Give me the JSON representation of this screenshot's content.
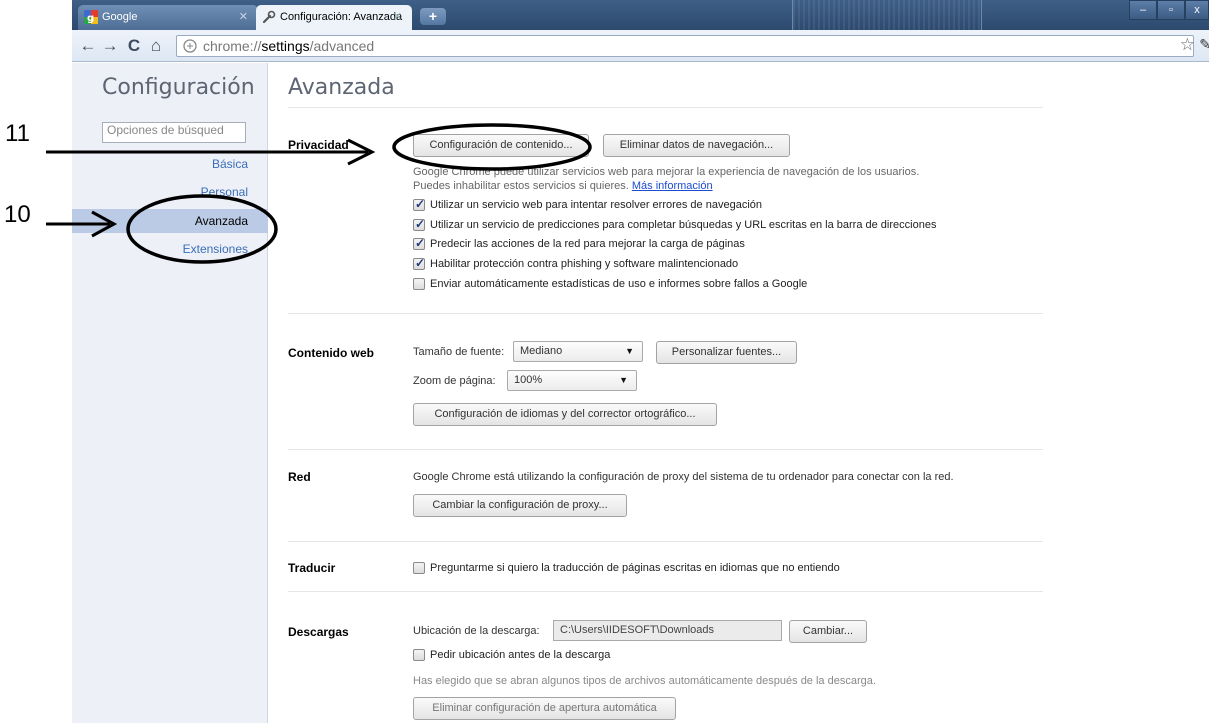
{
  "browser": {
    "tabs": [
      {
        "title": "Google",
        "active": false
      },
      {
        "title": "Configuración: Avanzada",
        "active": true
      }
    ],
    "new_tab_label": "+",
    "address": {
      "scheme": "chrome://",
      "host": "settings",
      "path": "/advanced"
    },
    "window_controls": {
      "minimize": "–",
      "maximize": "▫",
      "close": "x"
    }
  },
  "sidebar": {
    "title": "Configuración",
    "search_placeholder": "Opciones de búsqued",
    "items": [
      {
        "label": "Básica",
        "selected": false
      },
      {
        "label": "Personal",
        "selected": false
      },
      {
        "label": "Avanzada",
        "selected": true
      },
      {
        "label": "Extensiones",
        "selected": false
      }
    ]
  },
  "main": {
    "title": "Avanzada",
    "privacy": {
      "heading": "Privacidad",
      "content_settings_button": "Configuración de contenido...",
      "clear_data_button": "Eliminar datos de navegación...",
      "description_line1": "Google Chrome puede utilizar servicios web para mejorar la experiencia de navegación de los usuarios.",
      "description_line2": "Puedes inhabilitar estos servicios si quieres.",
      "more_info_link": "Más información",
      "options": [
        {
          "label": "Utilizar un servicio web para intentar resolver errores de navegación",
          "checked": true
        },
        {
          "label": "Utilizar un servicio de predicciones para completar búsquedas y URL escritas en la barra de direcciones",
          "checked": true
        },
        {
          "label": "Predecir las acciones de la red para mejorar la carga de páginas",
          "checked": true
        },
        {
          "label": "Habilitar protección contra phishing y software malintencionado",
          "checked": true
        },
        {
          "label": "Enviar automáticamente estadísticas de uso e informes sobre fallos a Google",
          "checked": false
        }
      ]
    },
    "web_content": {
      "heading": "Contenido web",
      "font_size_label": "Tamaño de fuente:",
      "font_size_value": "Mediano",
      "customize_fonts_button": "Personalizar fuentes...",
      "zoom_label": "Zoom de página:",
      "zoom_value": "100%",
      "languages_button": "Configuración de idiomas y del corrector ortográfico..."
    },
    "network": {
      "heading": "Red",
      "description": "Google Chrome está utilizando la configuración de proxy del sistema de tu ordenador para conectar con la red.",
      "proxy_button": "Cambiar la configuración de proxy..."
    },
    "translate": {
      "heading": "Traducir",
      "option": {
        "label": "Preguntarme si quiero la traducción de páginas escritas en idiomas que no entiendo",
        "checked": false
      }
    },
    "downloads": {
      "heading": "Descargas",
      "location_label": "Ubicación de la descarga:",
      "location_value": "C:\\Users\\IIDESOFT\\Downloads",
      "change_button": "Cambiar...",
      "ask_option": {
        "label": "Pedir ubicación antes de la descarga",
        "checked": false
      },
      "auto_open_note": "Has elegido que se abran algunos tipos de archivos automáticamente después de la descarga.",
      "clear_auto_open_button": "Eliminar configuración de apertura automática"
    }
  },
  "annotations": [
    {
      "number": "11",
      "target": "content-settings-button"
    },
    {
      "number": "10",
      "target": "sidebar-item-avanzada"
    }
  ]
}
